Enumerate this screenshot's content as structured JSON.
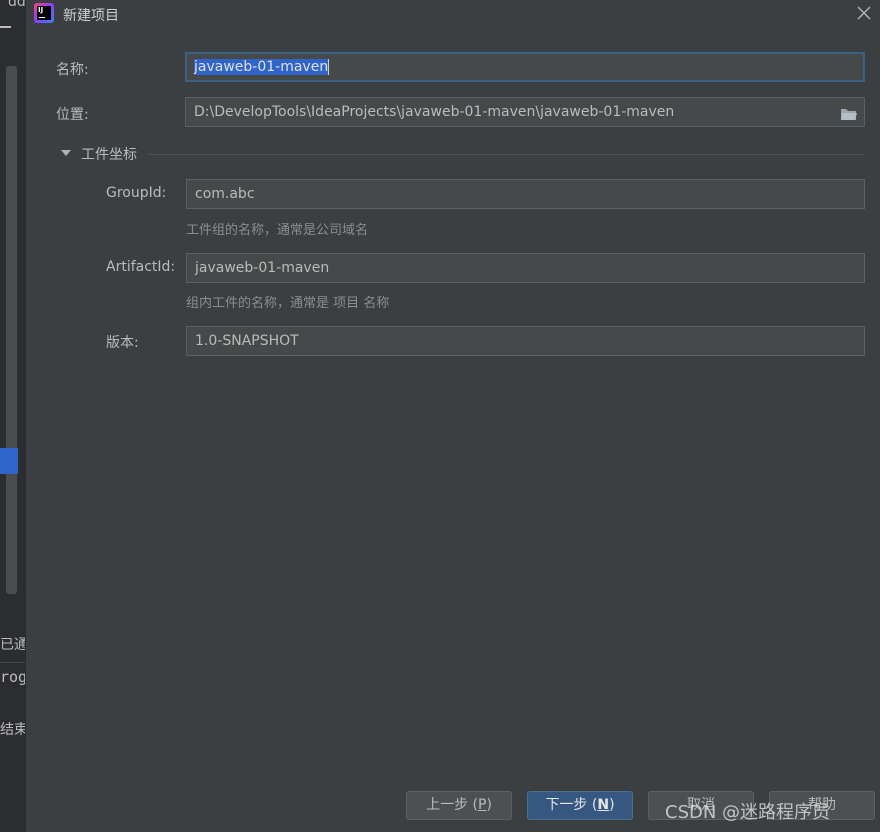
{
  "background_ide": {
    "top_text": "dd",
    "text_1": "已通过",
    "text_2": "rog",
    "text_3": "结束"
  },
  "dialog": {
    "title": "新建项目",
    "name_label": "名称:",
    "name_value": "javaweb-01-maven",
    "location_label": "位置:",
    "location_value": "D:\\DevelopTools\\IdeaProjects\\javaweb-01-maven\\javaweb-01-maven",
    "section_title": "工件坐标",
    "groupid_label": "GroupId:",
    "groupid_value": "com.abc",
    "groupid_hint": "工件组的名称，通常是公司域名",
    "artifactid_label": "ArtifactId:",
    "artifactid_value": "javaweb-01-maven",
    "artifactid_hint": "组内工件的名称，通常是 项目 名称",
    "version_label": "版本:",
    "version_value": "1.0-SNAPSHOT"
  },
  "buttons": {
    "prev": {
      "label": "上一步 (",
      "mnemonic": "P",
      "suffix": ")"
    },
    "next": {
      "label": "下一步 (",
      "mnemonic": "N",
      "suffix": ")"
    },
    "cancel": {
      "label": "取消"
    },
    "help": {
      "label": "帮助"
    }
  },
  "watermark": "CSDN @迷路程序员",
  "colors": {
    "dialog_bg": "#3c3f41",
    "field_bg": "#45494a",
    "selection": "#2f65ca",
    "primary_button": "#365880"
  }
}
